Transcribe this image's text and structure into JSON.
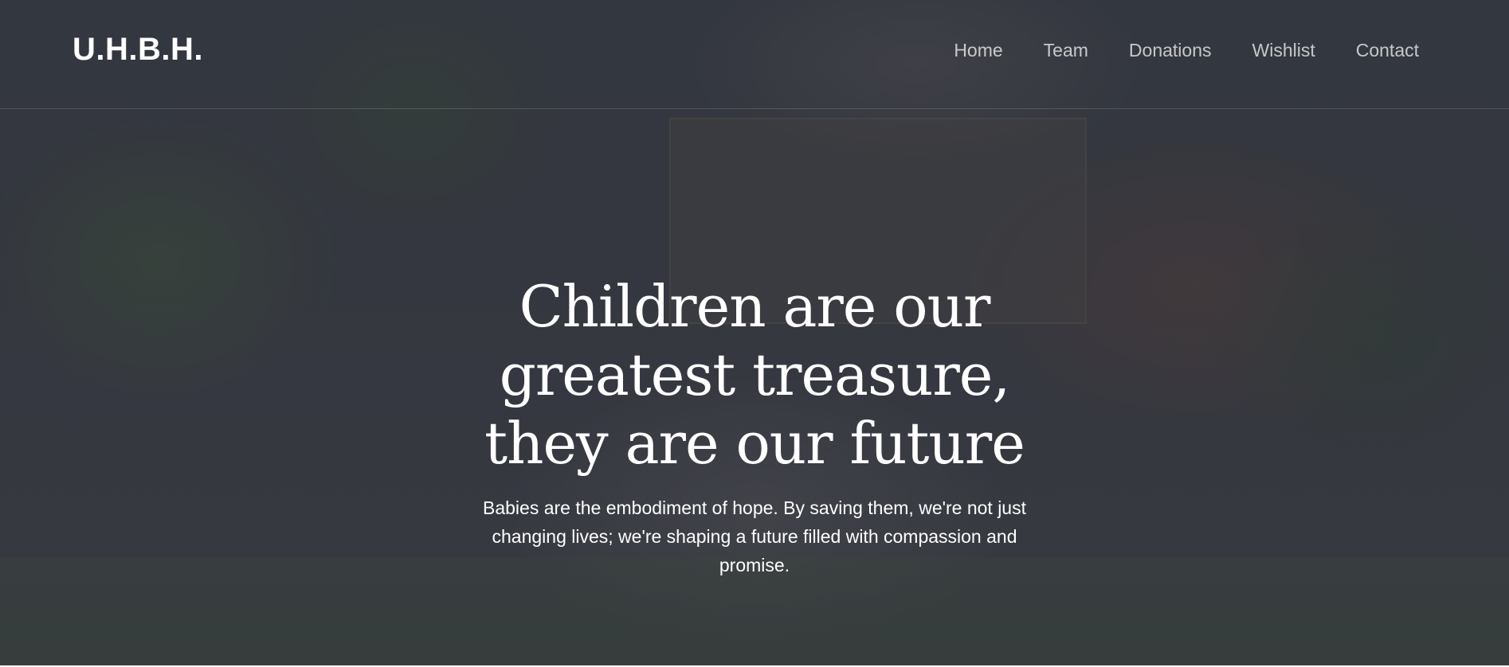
{
  "header": {
    "logo": "U.H.B.H.",
    "nav": [
      {
        "label": "Home"
      },
      {
        "label": "Team"
      },
      {
        "label": "Donations"
      },
      {
        "label": "Wishlist"
      },
      {
        "label": "Contact"
      }
    ]
  },
  "hero": {
    "headline": "Children are our greatest treasure, they are our future",
    "subtext": "Babies are the embodiment of hope. By saving them, we're not just changing lives; we're shaping a future filled with compassion and promise."
  },
  "colors": {
    "overlay": "#2c2f38",
    "text": "#ffffff"
  }
}
